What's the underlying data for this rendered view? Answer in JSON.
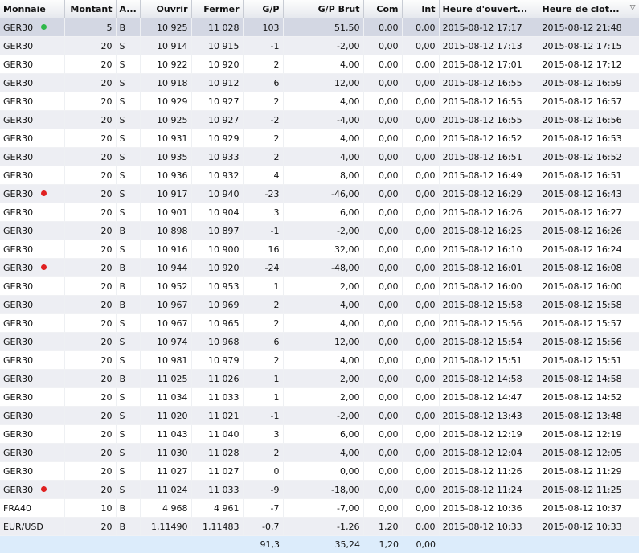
{
  "columns": [
    "Monnaie",
    "Montant",
    "A...",
    "Ouvrir",
    "Fermer",
    "G/P",
    "G/P Brut",
    "Com",
    "Int",
    "Heure d'ouvert...",
    "Heure de clot..."
  ],
  "sort_indicator": "▽",
  "colors": {
    "green_dot": "#2fb84a",
    "red_dot": "#e02020"
  },
  "rows": [
    {
      "monnaie": "GER30",
      "dot": "green",
      "montant": "5",
      "a": "B",
      "ouvrir": "10 925",
      "fermer": "11 028",
      "gp": "103",
      "gp_brut": "51,50",
      "com": "0,00",
      "int": "0,00",
      "open": "2015-08-12 17:17",
      "close": "2015-08-12 21:48"
    },
    {
      "monnaie": "GER30",
      "dot": "",
      "montant": "20",
      "a": "S",
      "ouvrir": "10 914",
      "fermer": "10 915",
      "gp": "-1",
      "gp_brut": "-2,00",
      "com": "0,00",
      "int": "0,00",
      "open": "2015-08-12 17:13",
      "close": "2015-08-12 17:15"
    },
    {
      "monnaie": "GER30",
      "dot": "",
      "montant": "20",
      "a": "S",
      "ouvrir": "10 922",
      "fermer": "10 920",
      "gp": "2",
      "gp_brut": "4,00",
      "com": "0,00",
      "int": "0,00",
      "open": "2015-08-12 17:01",
      "close": "2015-08-12 17:12"
    },
    {
      "monnaie": "GER30",
      "dot": "",
      "montant": "20",
      "a": "S",
      "ouvrir": "10 918",
      "fermer": "10 912",
      "gp": "6",
      "gp_brut": "12,00",
      "com": "0,00",
      "int": "0,00",
      "open": "2015-08-12 16:55",
      "close": "2015-08-12 16:59"
    },
    {
      "monnaie": "GER30",
      "dot": "",
      "montant": "20",
      "a": "S",
      "ouvrir": "10 929",
      "fermer": "10 927",
      "gp": "2",
      "gp_brut": "4,00",
      "com": "0,00",
      "int": "0,00",
      "open": "2015-08-12 16:55",
      "close": "2015-08-12 16:57"
    },
    {
      "monnaie": "GER30",
      "dot": "",
      "montant": "20",
      "a": "S",
      "ouvrir": "10 925",
      "fermer": "10 927",
      "gp": "-2",
      "gp_brut": "-4,00",
      "com": "0,00",
      "int": "0,00",
      "open": "2015-08-12 16:55",
      "close": "2015-08-12 16:56"
    },
    {
      "monnaie": "GER30",
      "dot": "",
      "montant": "20",
      "a": "S",
      "ouvrir": "10 931",
      "fermer": "10 929",
      "gp": "2",
      "gp_brut": "4,00",
      "com": "0,00",
      "int": "0,00",
      "open": "2015-08-12 16:52",
      "close": "2015-08-12 16:53"
    },
    {
      "monnaie": "GER30",
      "dot": "",
      "montant": "20",
      "a": "S",
      "ouvrir": "10 935",
      "fermer": "10 933",
      "gp": "2",
      "gp_brut": "4,00",
      "com": "0,00",
      "int": "0,00",
      "open": "2015-08-12 16:51",
      "close": "2015-08-12 16:52"
    },
    {
      "monnaie": "GER30",
      "dot": "",
      "montant": "20",
      "a": "S",
      "ouvrir": "10 936",
      "fermer": "10 932",
      "gp": "4",
      "gp_brut": "8,00",
      "com": "0,00",
      "int": "0,00",
      "open": "2015-08-12 16:49",
      "close": "2015-08-12 16:51"
    },
    {
      "monnaie": "GER30",
      "dot": "red",
      "montant": "20",
      "a": "S",
      "ouvrir": "10 917",
      "fermer": "10 940",
      "gp": "-23",
      "gp_brut": "-46,00",
      "com": "0,00",
      "int": "0,00",
      "open": "2015-08-12 16:29",
      "close": "2015-08-12 16:43"
    },
    {
      "monnaie": "GER30",
      "dot": "",
      "montant": "20",
      "a": "S",
      "ouvrir": "10 901",
      "fermer": "10 904",
      "gp": "3",
      "gp_brut": "6,00",
      "com": "0,00",
      "int": "0,00",
      "open": "2015-08-12 16:26",
      "close": "2015-08-12 16:27"
    },
    {
      "monnaie": "GER30",
      "dot": "",
      "montant": "20",
      "a": "B",
      "ouvrir": "10 898",
      "fermer": "10 897",
      "gp": "-1",
      "gp_brut": "-2,00",
      "com": "0,00",
      "int": "0,00",
      "open": "2015-08-12 16:25",
      "close": "2015-08-12 16:26"
    },
    {
      "monnaie": "GER30",
      "dot": "",
      "montant": "20",
      "a": "S",
      "ouvrir": "10 916",
      "fermer": "10 900",
      "gp": "16",
      "gp_brut": "32,00",
      "com": "0,00",
      "int": "0,00",
      "open": "2015-08-12 16:10",
      "close": "2015-08-12 16:24"
    },
    {
      "monnaie": "GER30",
      "dot": "red",
      "montant": "20",
      "a": "B",
      "ouvrir": "10 944",
      "fermer": "10 920",
      "gp": "-24",
      "gp_brut": "-48,00",
      "com": "0,00",
      "int": "0,00",
      "open": "2015-08-12 16:01",
      "close": "2015-08-12 16:08"
    },
    {
      "monnaie": "GER30",
      "dot": "",
      "montant": "20",
      "a": "B",
      "ouvrir": "10 952",
      "fermer": "10 953",
      "gp": "1",
      "gp_brut": "2,00",
      "com": "0,00",
      "int": "0,00",
      "open": "2015-08-12 16:00",
      "close": "2015-08-12 16:00"
    },
    {
      "monnaie": "GER30",
      "dot": "",
      "montant": "20",
      "a": "B",
      "ouvrir": "10 967",
      "fermer": "10 969",
      "gp": "2",
      "gp_brut": "4,00",
      "com": "0,00",
      "int": "0,00",
      "open": "2015-08-12 15:58",
      "close": "2015-08-12 15:58"
    },
    {
      "monnaie": "GER30",
      "dot": "",
      "montant": "20",
      "a": "S",
      "ouvrir": "10 967",
      "fermer": "10 965",
      "gp": "2",
      "gp_brut": "4,00",
      "com": "0,00",
      "int": "0,00",
      "open": "2015-08-12 15:56",
      "close": "2015-08-12 15:57"
    },
    {
      "monnaie": "GER30",
      "dot": "",
      "montant": "20",
      "a": "S",
      "ouvrir": "10 974",
      "fermer": "10 968",
      "gp": "6",
      "gp_brut": "12,00",
      "com": "0,00",
      "int": "0,00",
      "open": "2015-08-12 15:54",
      "close": "2015-08-12 15:56"
    },
    {
      "monnaie": "GER30",
      "dot": "",
      "montant": "20",
      "a": "S",
      "ouvrir": "10 981",
      "fermer": "10 979",
      "gp": "2",
      "gp_brut": "4,00",
      "com": "0,00",
      "int": "0,00",
      "open": "2015-08-12 15:51",
      "close": "2015-08-12 15:51"
    },
    {
      "monnaie": "GER30",
      "dot": "",
      "montant": "20",
      "a": "B",
      "ouvrir": "11 025",
      "fermer": "11 026",
      "gp": "1",
      "gp_brut": "2,00",
      "com": "0,00",
      "int": "0,00",
      "open": "2015-08-12 14:58",
      "close": "2015-08-12 14:58"
    },
    {
      "monnaie": "GER30",
      "dot": "",
      "montant": "20",
      "a": "S",
      "ouvrir": "11 034",
      "fermer": "11 033",
      "gp": "1",
      "gp_brut": "2,00",
      "com": "0,00",
      "int": "0,00",
      "open": "2015-08-12 14:47",
      "close": "2015-08-12 14:52"
    },
    {
      "monnaie": "GER30",
      "dot": "",
      "montant": "20",
      "a": "S",
      "ouvrir": "11 020",
      "fermer": "11 021",
      "gp": "-1",
      "gp_brut": "-2,00",
      "com": "0,00",
      "int": "0,00",
      "open": "2015-08-12 13:43",
      "close": "2015-08-12 13:48"
    },
    {
      "monnaie": "GER30",
      "dot": "",
      "montant": "20",
      "a": "S",
      "ouvrir": "11 043",
      "fermer": "11 040",
      "gp": "3",
      "gp_brut": "6,00",
      "com": "0,00",
      "int": "0,00",
      "open": "2015-08-12 12:19",
      "close": "2015-08-12 12:19"
    },
    {
      "monnaie": "GER30",
      "dot": "",
      "montant": "20",
      "a": "S",
      "ouvrir": "11 030",
      "fermer": "11 028",
      "gp": "2",
      "gp_brut": "4,00",
      "com": "0,00",
      "int": "0,00",
      "open": "2015-08-12 12:04",
      "close": "2015-08-12 12:05"
    },
    {
      "monnaie": "GER30",
      "dot": "",
      "montant": "20",
      "a": "S",
      "ouvrir": "11 027",
      "fermer": "11 027",
      "gp": "0",
      "gp_brut": "0,00",
      "com": "0,00",
      "int": "0,00",
      "open": "2015-08-12 11:26",
      "close": "2015-08-12 11:29"
    },
    {
      "monnaie": "GER30",
      "dot": "red",
      "montant": "20",
      "a": "S",
      "ouvrir": "11 024",
      "fermer": "11 033",
      "gp": "-9",
      "gp_brut": "-18,00",
      "com": "0,00",
      "int": "0,00",
      "open": "2015-08-12 11:24",
      "close": "2015-08-12 11:25"
    },
    {
      "monnaie": "FRA40",
      "dot": "",
      "montant": "10",
      "a": "B",
      "ouvrir": "4 968",
      "fermer": "4 961",
      "gp": "-7",
      "gp_brut": "-7,00",
      "com": "0,00",
      "int": "0,00",
      "open": "2015-08-12 10:36",
      "close": "2015-08-12 10:37"
    },
    {
      "monnaie": "EUR/USD",
      "dot": "",
      "montant": "20",
      "a": "B",
      "ouvrir": "1,11490",
      "fermer": "1,11483",
      "gp": "-0,7",
      "gp_brut": "-1,26",
      "com": "1,20",
      "int": "0,00",
      "open": "2015-08-12 10:33",
      "close": "2015-08-12 10:33"
    }
  ],
  "totals": {
    "gp": "91,3",
    "gp_brut": "35,24",
    "com": "1,20",
    "int": "0,00"
  }
}
